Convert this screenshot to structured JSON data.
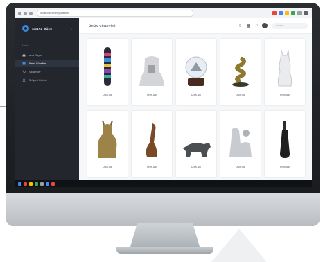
{
  "browser": {
    "url": "localhost/urun-yonetimi"
  },
  "sidebar": {
    "brand": "SANAL MÜZE",
    "collapse_icon": "chevron-left-icon",
    "menu_title": "Menü",
    "items": [
      {
        "label": "Ana Sayfa",
        "icon": "home-icon",
        "active": false
      },
      {
        "label": "Ürün Yönetimi",
        "icon": "box-icon",
        "active": true
      },
      {
        "label": "Siparişler",
        "icon": "cart-icon",
        "active": false
      },
      {
        "label": "Müşteri Listesi",
        "icon": "users-icon",
        "active": false
      }
    ]
  },
  "header": {
    "title": "ÜRÜN YÖNETİMİ",
    "search_placeholder": "Arama"
  },
  "products": [
    {
      "name": "Ürün Adı",
      "object": "striped-column"
    },
    {
      "name": "Ürün Adı",
      "object": "white-bust"
    },
    {
      "name": "Ürün Adı",
      "object": "snow-globe"
    },
    {
      "name": "Ürün Adı",
      "object": "gold-snake"
    },
    {
      "name": "Ürün Adı",
      "object": "white-cat"
    },
    {
      "name": "Ürün Adı",
      "object": "horned-figure"
    },
    {
      "name": "Ürün Adı",
      "object": "bronze-bird"
    },
    {
      "name": "Ürün Adı",
      "object": "rhino"
    },
    {
      "name": "Ürün Adı",
      "object": "white-figures"
    },
    {
      "name": "Ürün Adı",
      "object": "dark-statue"
    }
  ],
  "colors": {
    "sidebar": "#23272d",
    "accent": "#3c8ee0"
  }
}
